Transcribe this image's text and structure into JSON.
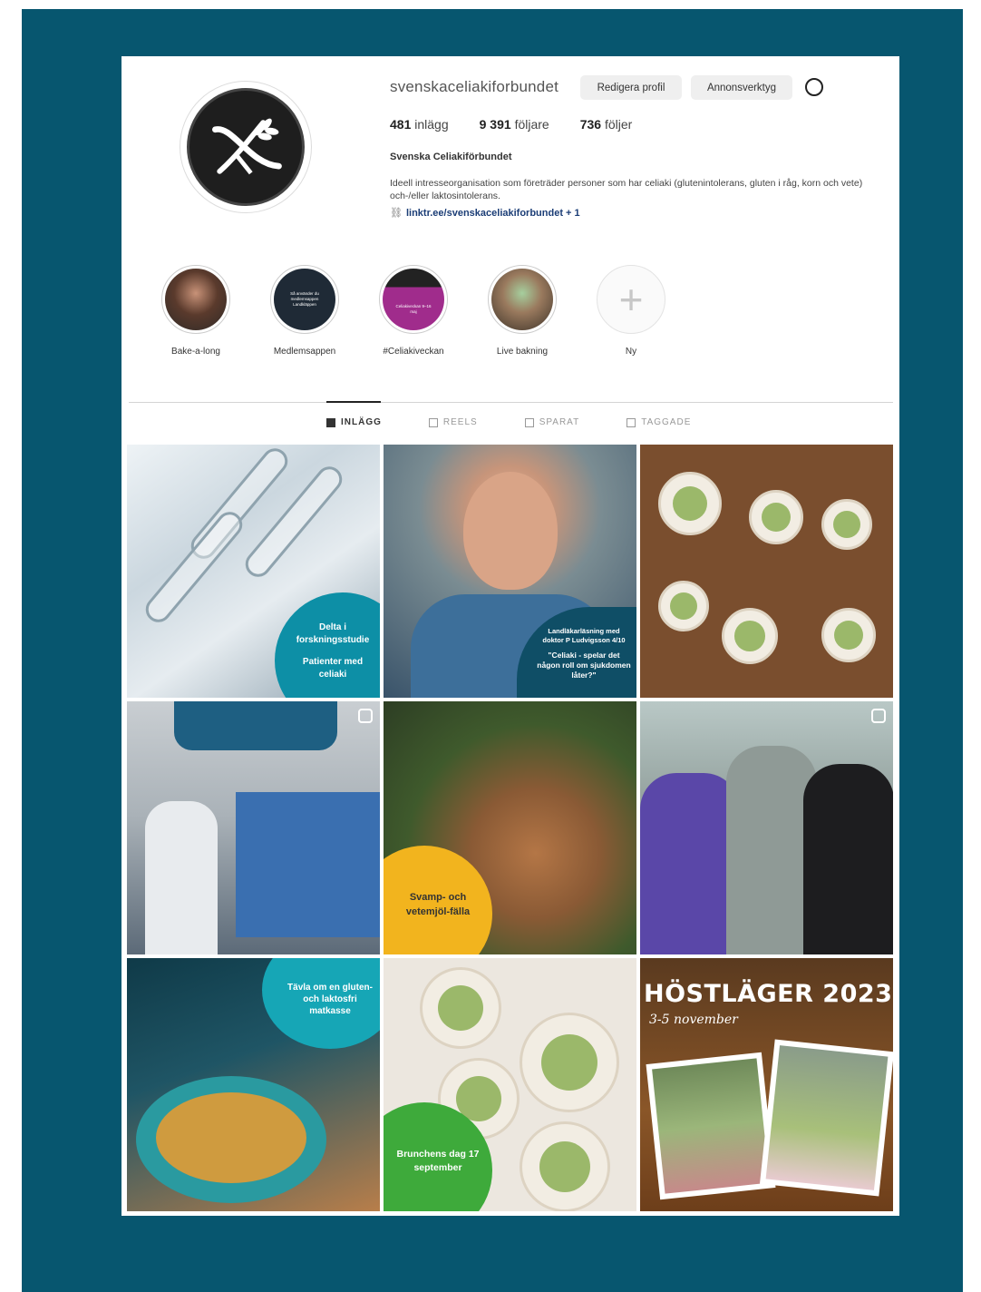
{
  "profile": {
    "username": "svenskaceliakiforbundet",
    "edit_label": "Redigera profil",
    "ads_label": "Annonsverktyg",
    "stats": {
      "posts": "481",
      "posts_label": "inlägg",
      "followers": "9 391",
      "followers_label": "följare",
      "following": "736",
      "following_label": "följer"
    },
    "full_name": "Svenska Celiakiförbundet",
    "bio": "Ideell intresseorganisation som företräder personer som har celiaki (glutenintolerans, gluten i råg, korn och vete) och-/eller laktosintolerans.",
    "link": "linktr.ee/svenskaceliakiforbundet + 1"
  },
  "highlights": [
    {
      "label": "Bake-a-long"
    },
    {
      "label": "Medlemsappen",
      "inner_text": "Så använder du medlemsappen Landkläppen"
    },
    {
      "label": "#Celiakiveckan",
      "inner_text": "Celiakiveckan 9–16 maj"
    },
    {
      "label": "Live bakning"
    },
    {
      "label": "Ny"
    }
  ],
  "tabs": [
    {
      "label": "INLÄGG",
      "active": true
    },
    {
      "label": "REELS",
      "active": false
    },
    {
      "label": "SPARAT",
      "active": false
    },
    {
      "label": "TAGGADE",
      "active": false
    }
  ],
  "posts": {
    "p1": {
      "line1": "Delta i forskningsstudie",
      "line2": "Patienter med celiaki"
    },
    "p2": {
      "line1": "Landläkarläsning med doktor P Ludvigsson 4/10",
      "line2": "\"Celiaki - spelar det någon roll om sjukdomen låter?\""
    },
    "p5": {
      "text": "Svamp- och vetemjöl-fälla"
    },
    "p7": {
      "text": "Tävla om en gluten- och laktosfri matkasse"
    },
    "p8": {
      "text": "Brunchens dag 17 september"
    },
    "p9": {
      "title": "HÖSTLÄGER 2023",
      "subtitle": "3-5 november"
    }
  },
  "colors": {
    "frame": "#07566f",
    "accent_teal": "#0d8fa6",
    "yellow": "#f2b41e",
    "green": "#3eaa3b"
  }
}
